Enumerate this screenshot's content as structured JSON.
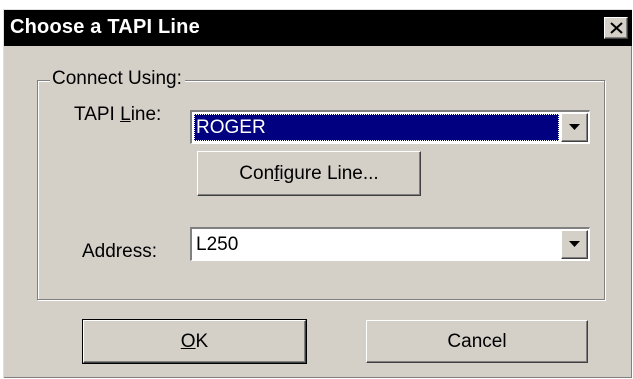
{
  "window": {
    "title": "Choose a TAPI Line",
    "close_glyph": "✕"
  },
  "group": {
    "label": "Connect Using:"
  },
  "tapi_line": {
    "label_pre": "TAPI ",
    "label_mnemonic": "L",
    "label_post": "ine:",
    "value": "ROGER"
  },
  "configure_button": {
    "label_pre": "Con",
    "label_mnemonic": "f",
    "label_post": "igure Line..."
  },
  "address": {
    "label": "Address:",
    "value": "L250"
  },
  "ok_button": {
    "label_mnemonic": "O",
    "label_post": "K"
  },
  "cancel_button": {
    "label": "Cancel"
  },
  "colors": {
    "titlebar": "#000000",
    "face": "#d4d0c8",
    "selection": "#000080"
  }
}
